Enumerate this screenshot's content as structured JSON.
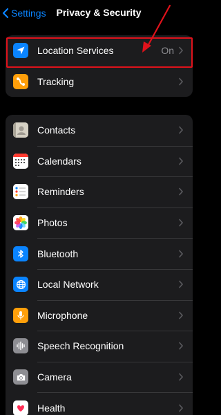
{
  "nav": {
    "back_label": "Settings",
    "title": "Privacy & Security"
  },
  "group1": [
    {
      "label": "Location Services",
      "value": "On",
      "icon": "location-arrow-icon",
      "color": "#0a84ff"
    },
    {
      "label": "Tracking",
      "value": "",
      "icon": "tracking-icon",
      "color": "#ff9f0a"
    }
  ],
  "group2": [
    {
      "label": "Contacts",
      "icon": "contacts-icon"
    },
    {
      "label": "Calendars",
      "icon": "calendar-icon"
    },
    {
      "label": "Reminders",
      "icon": "reminders-icon"
    },
    {
      "label": "Photos",
      "icon": "photos-icon"
    },
    {
      "label": "Bluetooth",
      "icon": "bluetooth-icon",
      "color": "#0a84ff"
    },
    {
      "label": "Local Network",
      "icon": "globe-icon",
      "color": "#0a84ff"
    },
    {
      "label": "Microphone",
      "icon": "microphone-icon",
      "color": "#ff9f0a"
    },
    {
      "label": "Speech Recognition",
      "icon": "waveform-icon",
      "color": "#8e8e93"
    },
    {
      "label": "Camera",
      "icon": "camera-icon",
      "color": "#8e8e93"
    },
    {
      "label": "Health",
      "icon": "health-heart-icon"
    }
  ],
  "colors": {
    "accent": "#0a84ff",
    "highlight": "#e0121b",
    "background": "#000000",
    "group": "#1c1c1e"
  }
}
